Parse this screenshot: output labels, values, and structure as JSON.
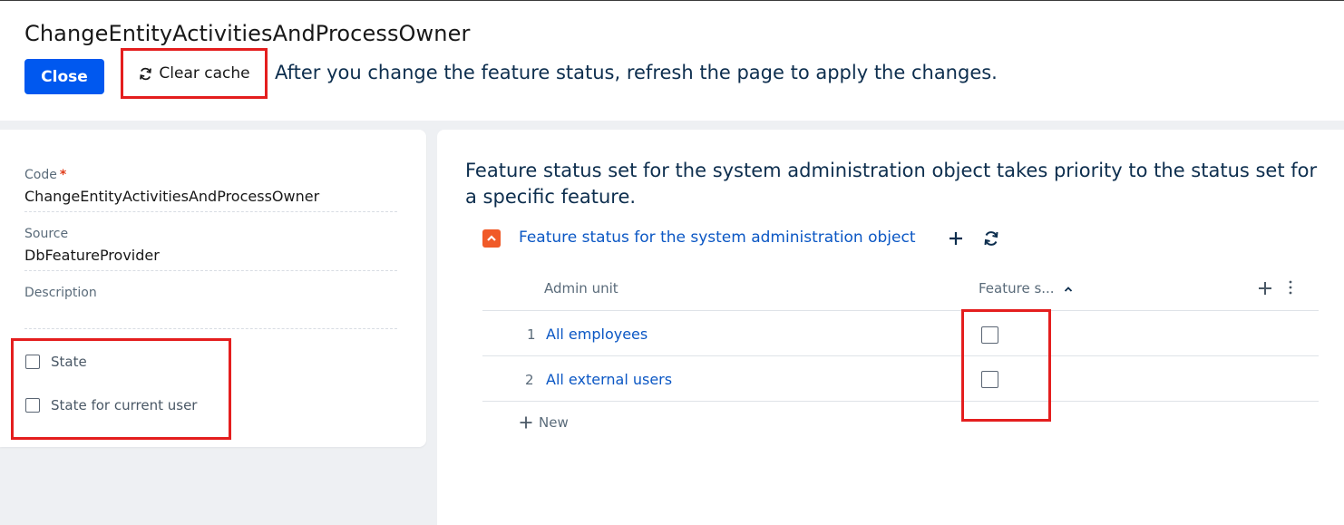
{
  "header": {
    "title": "ChangeEntityActivitiesAndProcessOwner",
    "close_label": "Close",
    "clear_cache_label": "Clear cache",
    "hint": "After you change the feature status, refresh the page to apply the changes."
  },
  "form": {
    "code_label": "Code",
    "required_mark": "*",
    "code_value": "ChangeEntityActivitiesAndProcessOwner",
    "source_label": "Source",
    "source_value": "DbFeatureProvider",
    "description_label": "Description",
    "description_value": "",
    "state_label": "State",
    "state_checked": false,
    "state_current_user_label": "State for current user",
    "state_current_user_checked": false
  },
  "detail": {
    "note": "Feature status set for the system administration object takes priority to the status set for a specific feature.",
    "title": "Feature status for the system administration object",
    "columns": [
      "Admin unit",
      "Feature s..."
    ],
    "rows": [
      {
        "num": "1",
        "admin_unit": "All employees",
        "feature_status": false
      },
      {
        "num": "2",
        "admin_unit": "All external users",
        "feature_status": false
      }
    ],
    "new_label": "New"
  },
  "icons": {
    "clear_cache": "refresh-icon",
    "collapse": "chevron-up-icon",
    "add": "plus-icon",
    "refresh": "refresh-icon",
    "sort": "sort-ascending-icon",
    "menu": "vertical-dots-icon"
  },
  "colors": {
    "primary_button": "#0058ef",
    "highlight": "#e41e1e",
    "link": "#0b57c4",
    "collapse_button": "#f05a28"
  }
}
